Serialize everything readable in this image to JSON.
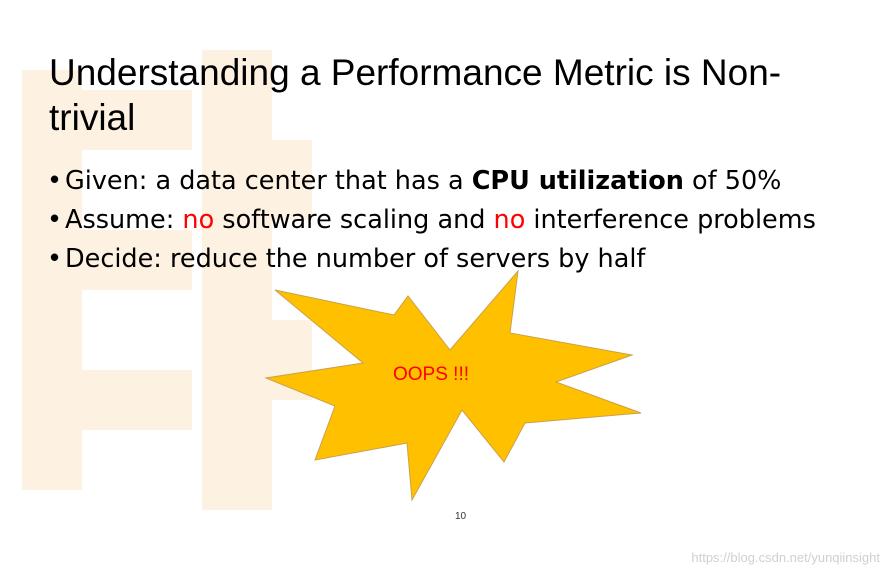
{
  "slide": {
    "title": "Understanding a Performance Metric is Non-trivial",
    "bullets": [
      {
        "marker": "•",
        "parts": [
          {
            "text": "Given: a data center that has a ",
            "style": "normal"
          },
          {
            "text": "CPU utilization",
            "style": "bold"
          },
          {
            "text": " of 50%",
            "style": "normal"
          }
        ]
      },
      {
        "marker": "•",
        "parts": [
          {
            "text": "Assume: ",
            "style": "normal"
          },
          {
            "text": "no",
            "style": "red"
          },
          {
            "text": " software scaling and ",
            "style": "normal"
          },
          {
            "text": "no",
            "style": "red"
          },
          {
            "text": " interference problems",
            "style": "normal"
          }
        ]
      },
      {
        "marker": "•",
        "parts": [
          {
            "text": "Decide: reduce the number of servers by half",
            "style": "normal"
          }
        ]
      }
    ],
    "callout_text": "OOPS !!!",
    "page_number": "10",
    "watermark_credit": "https://blog.csdn.net/yunqiinsight"
  },
  "colors": {
    "starburst_fill": "#ffc000",
    "starburst_stroke": "#c9a14a",
    "emphasis_red": "#ff0000",
    "background_watermark": "#fdf1e2"
  }
}
